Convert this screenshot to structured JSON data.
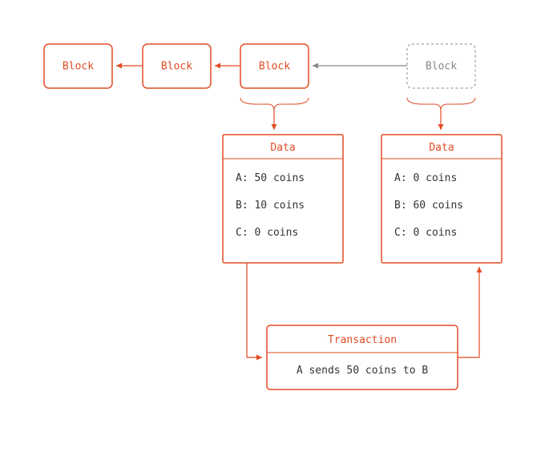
{
  "blocks": {
    "b1": "Block",
    "b2": "Block",
    "b3": "Block",
    "b4": "Block"
  },
  "dataBoxes": {
    "left": {
      "title": "Data",
      "rows": [
        "A: 50 coins",
        "B: 10 coins",
        "C: 0 coins"
      ]
    },
    "right": {
      "title": "Data",
      "rows": [
        "A: 0 coins",
        "B: 60 coins",
        "C: 0 coins"
      ]
    }
  },
  "transaction": {
    "title": "Transaction",
    "body": "A sends 50 coins to B"
  }
}
